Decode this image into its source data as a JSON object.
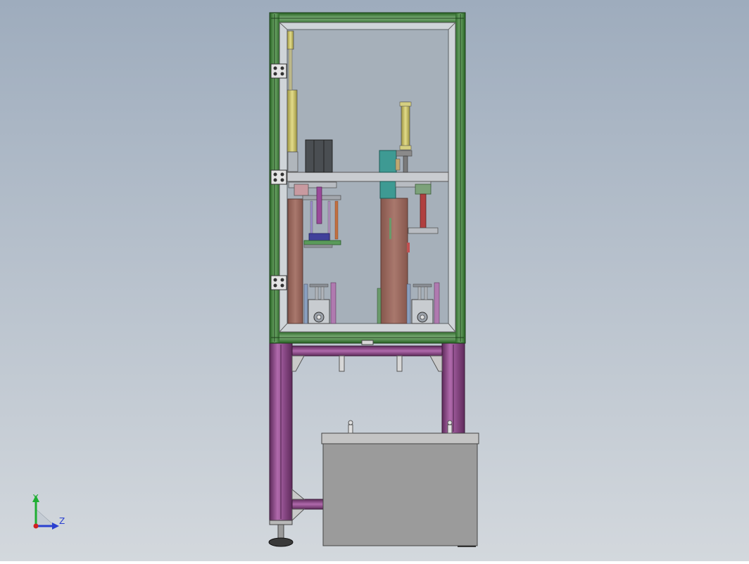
{
  "viewport": {
    "background_top": "#9eacbd",
    "background_bottom": "#d3d8dd"
  },
  "colors": {
    "frame_green": "#3f7a3a",
    "frame_green_light": "#7fb07a",
    "frame_purple": "#7d3c79",
    "frame_purple_light": "#b06aac",
    "glass": "#a6b0ba",
    "base_panel": "#9b9b9b",
    "base_panel_top": "#c4c4c4",
    "column_brown": "#9a6b61",
    "cylinder_yellow": "#c8c06a",
    "block_teal": "#3e9a93",
    "block_dark": "#4a4e52",
    "rod_magenta": "#9a4a9a",
    "rod_red": "#b04040",
    "plate_blue": "#40409a"
  },
  "triad": {
    "y_label": "Y",
    "z_label": "Z",
    "y_color": "#1fae32",
    "z_color": "#2a40d0",
    "origin_color": "#d02020"
  },
  "model": {
    "view_name": "machine-cabinet-side-view"
  }
}
